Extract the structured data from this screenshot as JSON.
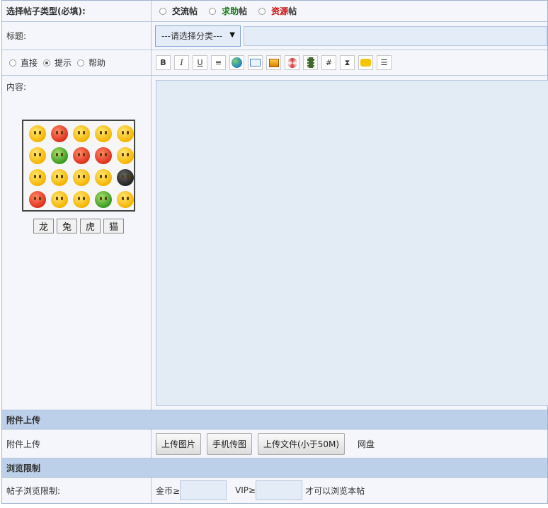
{
  "post_type": {
    "label": "选择帖子类型(必填):",
    "options": [
      {
        "prefix": "交流",
        "suffix": "帖",
        "color": "#222222"
      },
      {
        "prefix": "求助",
        "suffix": "帖",
        "color": "#1a7a1a"
      },
      {
        "prefix": "资源",
        "suffix": "帖",
        "color": "#cc1111"
      }
    ]
  },
  "title_row": {
    "label": "标题:",
    "category_select": "---请选择分类---",
    "title_input_value": ""
  },
  "mode": {
    "options": [
      "直接",
      "提示",
      "帮助"
    ],
    "selected": "提示"
  },
  "toolbar": {
    "buttons": [
      "B",
      "I",
      "U",
      "≡",
      "globe-icon",
      "email-icon",
      "image-icon",
      "flash-icon",
      "film-icon",
      "code-icon",
      "timer-icon",
      "quote-icon",
      "list-icon"
    ]
  },
  "content": {
    "label": "内容:",
    "emoticon_tabs": [
      "龙",
      "兔",
      "虎",
      "猫"
    ]
  },
  "attachments": {
    "section_title": "附件上传",
    "label": "附件上传",
    "buttons": [
      "上传图片",
      "手机传图",
      "上传文件(小于50M)"
    ],
    "cloud_link": "网盘"
  },
  "browse_limit": {
    "section_title": "浏览限制",
    "label": "帖子浏览限制:",
    "gold_label": "金币≥",
    "vip_label": "VIP≥",
    "suffix": "才可以浏览本帖"
  }
}
